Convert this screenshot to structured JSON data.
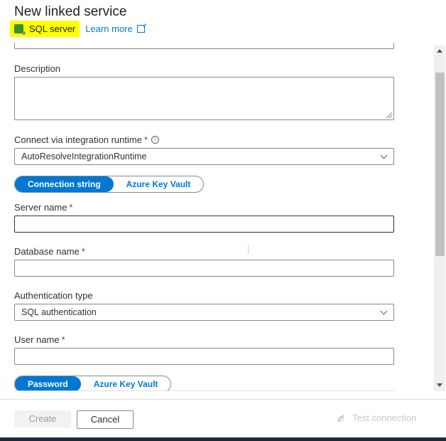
{
  "header": {
    "title": "New linked service",
    "connector": "SQL server",
    "learn_more": "Learn more",
    "highlight_color": "#ffff00"
  },
  "form": {
    "description": {
      "label": "Description",
      "value": ""
    },
    "integration_runtime": {
      "label": "Connect via integration runtime",
      "required": "*",
      "info": "i",
      "value": "AutoResolveIntegrationRuntime"
    },
    "connection_toggle": {
      "options": [
        "Connection string",
        "Azure Key Vault"
      ],
      "selected": "Connection string"
    },
    "server_name": {
      "label": "Server name",
      "required": "*",
      "value": ""
    },
    "database_name": {
      "label": "Database name",
      "required": "*",
      "value": ""
    },
    "authentication_type": {
      "label": "Authentication type",
      "value": "SQL authentication"
    },
    "user_name": {
      "label": "User name",
      "required": "*",
      "value": ""
    },
    "password_toggle": {
      "options": [
        "Password",
        "Azure Key Vault"
      ],
      "selected": "Password"
    }
  },
  "footer": {
    "create": "Create",
    "cancel": "Cancel",
    "test_connection": "Test connection"
  },
  "colors": {
    "accent": "#0078d4",
    "required": "#a4262c"
  }
}
